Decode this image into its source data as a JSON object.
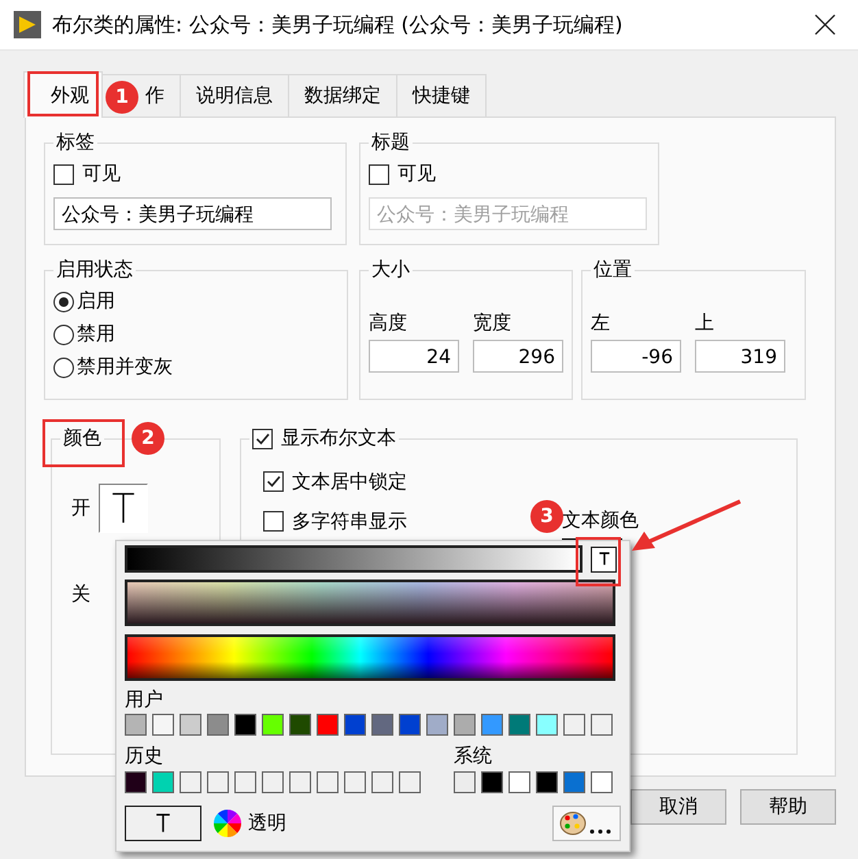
{
  "window": {
    "title": "布尔类的属性: 公众号：美男子玩编程 (公众号：美男子玩编程)"
  },
  "tabs": [
    {
      "label": "外观",
      "selected": true
    },
    {
      "label": "作",
      "selected": false
    },
    {
      "label": "说明信息",
      "selected": false
    },
    {
      "label": "数据绑定",
      "selected": false
    },
    {
      "label": "快捷键",
      "selected": false
    }
  ],
  "label_group": {
    "title": "标签",
    "visible": {
      "label": "可见",
      "checked": false
    },
    "value": "公众号：美男子玩编程",
    "disabled": false
  },
  "caption_group": {
    "title": "标题",
    "visible": {
      "label": "可见",
      "checked": false
    },
    "value": "公众号：美男子玩编程",
    "disabled": true
  },
  "enable_state": {
    "title": "启用状态",
    "options": [
      {
        "label": "启用",
        "selected": true
      },
      {
        "label": "禁用",
        "selected": false
      },
      {
        "label": "禁用并变灰",
        "selected": false
      }
    ]
  },
  "size": {
    "title": "大小",
    "fields": [
      {
        "label": "高度",
        "value": "24"
      },
      {
        "label": "宽度",
        "value": "296"
      }
    ]
  },
  "position": {
    "title": "位置",
    "fields": [
      {
        "label": "左",
        "value": "-96"
      },
      {
        "label": "上",
        "value": "319"
      }
    ]
  },
  "color_group": {
    "title": "颜色",
    "on_label": "开",
    "off_label": "关"
  },
  "bool_text": {
    "show": {
      "label": "显示布尔文本",
      "checked": true
    },
    "options": [
      {
        "label": "文本居中锁定",
        "checked": true
      },
      {
        "label": "多字符串显示",
        "checked": false
      }
    ],
    "text_color_label": "文本颜色"
  },
  "buttons": [
    "取消",
    "帮助"
  ],
  "color_picker": {
    "user_label": "用户",
    "user_colors": [
      {
        "color": "#b4b4b4"
      },
      {
        "color": "#f5f5f5"
      },
      {
        "color": "#cccccc"
      },
      {
        "color": "#8c8c8c"
      },
      {
        "color": "#000000"
      },
      {
        "color": "#66ff00"
      },
      {
        "color": "#1f4a00"
      },
      {
        "color": "#ff0000"
      },
      {
        "color": "#0040d0"
      },
      {
        "color": "#626880"
      },
      {
        "color": "#0040d0"
      },
      {
        "color": "#a0acc8"
      },
      {
        "color": "#acacac"
      },
      {
        "color": "#3399ff"
      },
      {
        "color": "#007a78"
      },
      {
        "color": "#88ffff"
      },
      {
        "color": "#f0f0f0"
      },
      {
        "color": "#f0f0f0"
      }
    ],
    "history_label": "历史",
    "history_colors": [
      {
        "color": "#200018"
      },
      {
        "color": "#00d2b0"
      },
      {
        "color": "#f0f0f0"
      },
      {
        "color": "#f0f0f0"
      },
      {
        "color": "#f0f0f0"
      },
      {
        "color": "#f0f0f0"
      },
      {
        "color": "#f0f0f0"
      },
      {
        "color": "#f0f0f0"
      },
      {
        "color": "#f0f0f0"
      },
      {
        "color": "#f0f0f0"
      },
      {
        "color": "#f0f0f0"
      }
    ],
    "system_label": "系统",
    "system_colors": [
      {
        "color": "#ececec"
      },
      {
        "color": "#000000"
      },
      {
        "color": "#ffffff"
      },
      {
        "color": "#000000"
      },
      {
        "color": "#0a70d0"
      },
      {
        "color": "#ffffff"
      }
    ],
    "transparent_label": "透明"
  },
  "annotations": [
    {
      "number": "1"
    },
    {
      "number": "2"
    },
    {
      "number": "3"
    }
  ]
}
